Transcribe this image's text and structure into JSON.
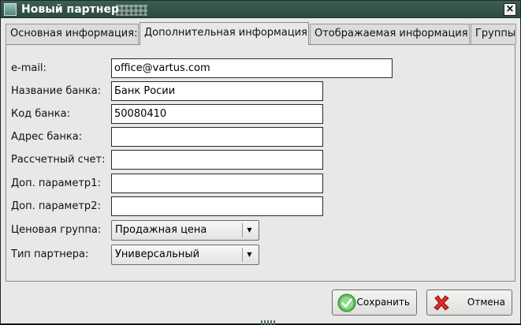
{
  "window": {
    "title": "Новый партнер",
    "icon": "app-window-icon",
    "close_glyph": "×",
    "accent": "#2f5148"
  },
  "tabs": [
    {
      "label": "Основная информация:",
      "active": false
    },
    {
      "label": "Дополнительная информация",
      "active": true
    },
    {
      "label": "Отображаемая информация",
      "active": false
    },
    {
      "label": "Группы",
      "active": false
    }
  ],
  "form": {
    "email": {
      "label": "e-mail:",
      "value": "office@vartus.com"
    },
    "bank_name": {
      "label": "Название банка:",
      "value": "Банк Росии"
    },
    "bank_code": {
      "label": "Код банка:",
      "value": "50080410"
    },
    "bank_address": {
      "label": "Адрес банка:",
      "value": ""
    },
    "account": {
      "label": "Рассчетный счет:",
      "value": ""
    },
    "param1": {
      "label": "Доп. параметр1:",
      "value": ""
    },
    "param2": {
      "label": "Доп. параметр2:",
      "value": ""
    },
    "price_group": {
      "label": "Ценовая группа:",
      "value": "Продажная цена"
    },
    "partner_type": {
      "label": "Тип партнера:",
      "value": "Универсальный"
    }
  },
  "buttons": {
    "save": {
      "label": "Сохранить",
      "icon": "check-circle-icon",
      "color": "#3aa63a"
    },
    "cancel": {
      "label": "Отмена",
      "icon": "red-x-icon",
      "color": "#d62020"
    }
  }
}
